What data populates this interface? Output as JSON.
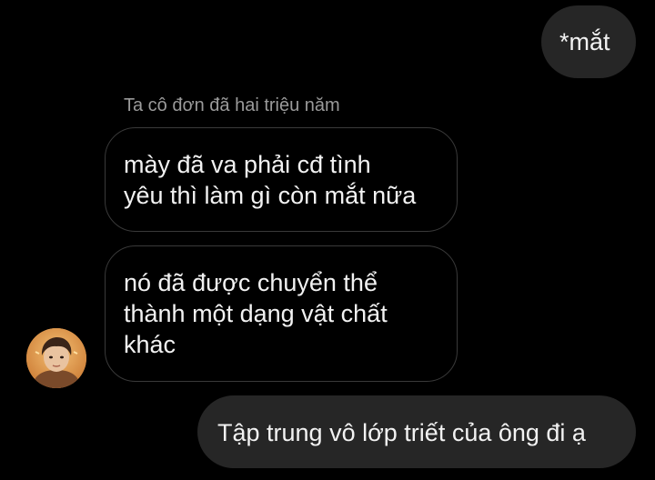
{
  "chat": {
    "outgoing_correction": "*mắt",
    "sender_name": "Ta cô đơn đã hai triệu năm",
    "incoming_1": "mày đã va phải cđ tình\nyêu thì làm gì còn mắt nữa",
    "incoming_2": "nó đã được chuyển thể\nthành một dạng vật chất\nkhác",
    "outgoing_reply": "Tập trung vô lớp triết của ông đi ạ"
  },
  "colors": {
    "background": "#000000",
    "outgoing_bubble": "#262626",
    "incoming_border": "#3a3a3a",
    "sender_name": "#9a9a9a",
    "text": "#f2f2f2"
  },
  "icons": {
    "avatar": "profile-photo"
  }
}
